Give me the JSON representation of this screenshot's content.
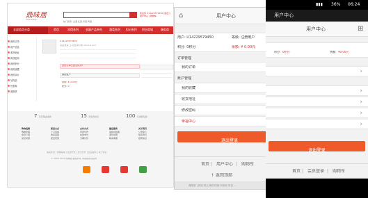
{
  "desktop": {
    "logo": "鼎味居",
    "logo_sub": "DINGWEIJU",
    "search_hot": "热门搜索: 白酒  红酒  洋酒  啤酒",
    "welcome": "欢迎您 U14229579450 [退出] | 用户中心 | 购物车",
    "nav_home": "全部商品分类",
    "nav": [
      "首页",
      "宾馆系列",
      "农副产品系列",
      "酒类系列",
      "Kan系列",
      "积分商城",
      "服务商"
    ],
    "sidebar": [
      "我的订单",
      "用户信息",
      "收货地址",
      "修改密码",
      "我的积分",
      "我的收藏",
      "我的评价",
      "站内信",
      "优惠券",
      "退换货"
    ],
    "user_id": "U14229579450",
    "user_line": "欢迎登录,上次登录时间 2015-01-07",
    "notice": "您的订单已提交成功!",
    "section_title": "我的账户",
    "balance_label": "余额: ¥ 0.00元",
    "points_label": "积分: 0",
    "stats": [
      {
        "n": "7",
        "l": "天无理由退换"
      },
      {
        "n": "15",
        "l": "天免费换货"
      },
      {
        "n": "100",
        "l": "元满额包邮"
      }
    ],
    "footer_cols": [
      [
        "购物指南",
        "购物流程",
        "会员介绍",
        "常见问题"
      ],
      [
        "配送方式",
        "上门自提",
        "快递运输",
        "配送范围"
      ],
      [
        "支付方式",
        "货到付款",
        "在线支付",
        "分期付款"
      ],
      [
        "售后服务",
        "退换货政策",
        "退款说明",
        "联系客服"
      ],
      [
        "关于我们",
        "公司简介",
        "联系我们",
        "招聘信息"
      ]
    ],
    "copyright": "© 2008-2015 鼎味居 版权所有, 并保留所有权利",
    "links": "免责条款 | 购物指南 | 配送方式 | 支付方式 | 售后服务 | 关于我们"
  },
  "mobileA": {
    "title": "用户中心",
    "user_label": "用户: U14229579450",
    "user_type": "等级: 注册用户",
    "points": "积分: 0积分",
    "balance": "余额: ¥ 0.00元",
    "section_orders": "订单管理",
    "my_orders": "我的订单",
    "section_account": "账户管理",
    "items": [
      "我的收藏",
      "收货地址",
      "修改密码",
      "幸福中心"
    ],
    "logout": "退出登录",
    "footer_links": [
      "首页",
      "用户中心",
      "购物车"
    ],
    "back_top": "返回顶部",
    "copyright": "鼎味居 | 网站 网上商城 快速 你我他 来自 ..."
  },
  "mobileB": {
    "time": "06:24",
    "battery": "36%",
    "title": "用户中心",
    "points": "积分:",
    "points_val": "0积分",
    "balance": "余额:",
    "balance_val": "¥0.00元",
    "logout": "退出登录",
    "footer_links": [
      "首页",
      "会员登录",
      "购物车"
    ]
  }
}
